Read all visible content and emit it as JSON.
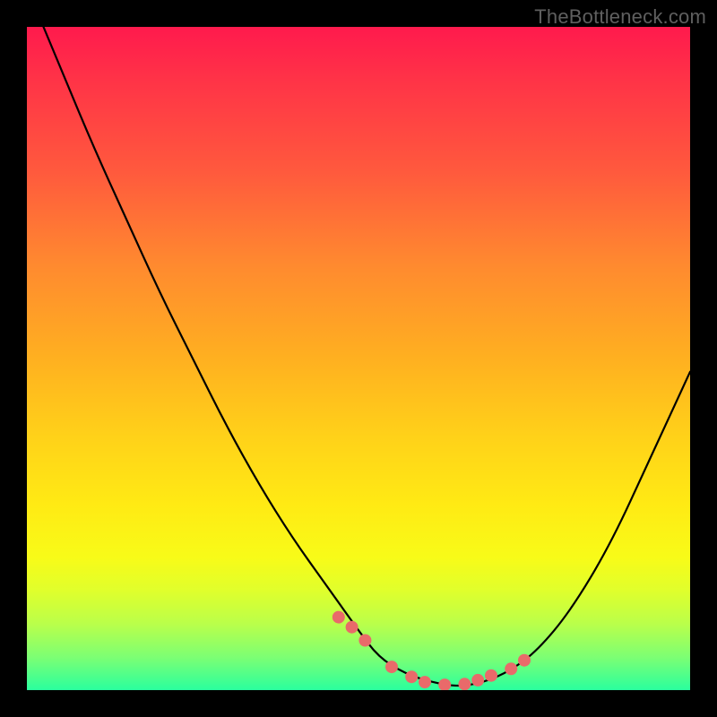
{
  "watermark": "TheBottleneck.com",
  "chart_data": {
    "type": "line",
    "title": "",
    "xlabel": "",
    "ylabel": "",
    "xlim": [
      0,
      100
    ],
    "ylim": [
      0,
      100
    ],
    "grid": false,
    "background": "heat-gradient",
    "series": [
      {
        "name": "bottleneck-curve",
        "x": [
          0,
          5,
          10,
          15,
          20,
          25,
          30,
          35,
          40,
          45,
          50,
          53,
          57,
          61,
          65,
          69,
          73,
          77,
          82,
          88,
          94,
          100
        ],
        "y": [
          106,
          94,
          82,
          71,
          60,
          50,
          40,
          31,
          23,
          16,
          9,
          5,
          2.5,
          1.2,
          0.5,
          1.2,
          3,
          6,
          12,
          22,
          35,
          48
        ]
      }
    ],
    "markers": {
      "name": "highlighted-points",
      "color": "#e96a6a",
      "x": [
        47,
        49,
        51,
        55,
        58,
        60,
        63,
        66,
        68,
        70,
        73,
        75
      ],
      "y": [
        11,
        9.5,
        7.5,
        3.5,
        2.0,
        1.2,
        0.8,
        0.9,
        1.5,
        2.2,
        3.2,
        4.5
      ]
    }
  },
  "colors": {
    "page_bg": "#000000",
    "gradient_top": "#ff1a4d",
    "gradient_bottom": "#2aff9e",
    "curve": "#000000",
    "marker": "#e96a6a",
    "watermark": "#5f5f5f"
  }
}
